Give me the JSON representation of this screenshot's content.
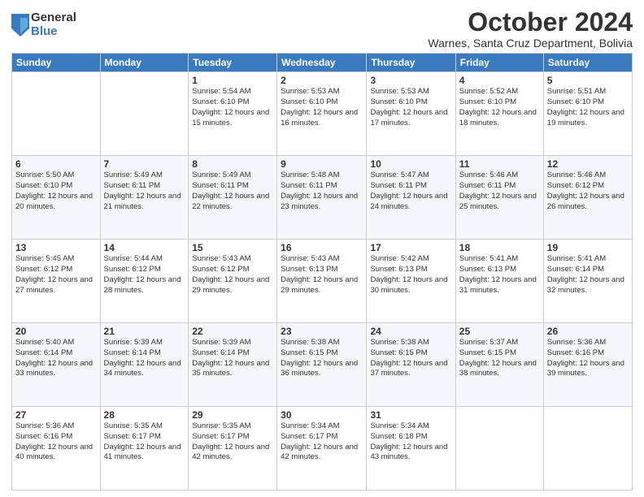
{
  "logo": {
    "general": "General",
    "blue": "Blue"
  },
  "header": {
    "month": "October 2024",
    "location": "Warnes, Santa Cruz Department, Bolivia"
  },
  "days_of_week": [
    "Sunday",
    "Monday",
    "Tuesday",
    "Wednesday",
    "Thursday",
    "Friday",
    "Saturday"
  ],
  "weeks": [
    [
      {
        "day": "",
        "info": ""
      },
      {
        "day": "",
        "info": ""
      },
      {
        "day": "1",
        "info": "Sunrise: 5:54 AM\nSunset: 6:10 PM\nDaylight: 12 hours\nand 15 minutes."
      },
      {
        "day": "2",
        "info": "Sunrise: 5:53 AM\nSunset: 6:10 PM\nDaylight: 12 hours\nand 16 minutes."
      },
      {
        "day": "3",
        "info": "Sunrise: 5:53 AM\nSunset: 6:10 PM\nDaylight: 12 hours\nand 17 minutes."
      },
      {
        "day": "4",
        "info": "Sunrise: 5:52 AM\nSunset: 6:10 PM\nDaylight: 12 hours\nand 18 minutes."
      },
      {
        "day": "5",
        "info": "Sunrise: 5:51 AM\nSunset: 6:10 PM\nDaylight: 12 hours\nand 19 minutes."
      }
    ],
    [
      {
        "day": "6",
        "info": "Sunrise: 5:50 AM\nSunset: 6:10 PM\nDaylight: 12 hours\nand 20 minutes."
      },
      {
        "day": "7",
        "info": "Sunrise: 5:49 AM\nSunset: 6:11 PM\nDaylight: 12 hours\nand 21 minutes."
      },
      {
        "day": "8",
        "info": "Sunrise: 5:49 AM\nSunset: 6:11 PM\nDaylight: 12 hours\nand 22 minutes."
      },
      {
        "day": "9",
        "info": "Sunrise: 5:48 AM\nSunset: 6:11 PM\nDaylight: 12 hours\nand 23 minutes."
      },
      {
        "day": "10",
        "info": "Sunrise: 5:47 AM\nSunset: 6:11 PM\nDaylight: 12 hours\nand 24 minutes."
      },
      {
        "day": "11",
        "info": "Sunrise: 5:46 AM\nSunset: 6:11 PM\nDaylight: 12 hours\nand 25 minutes."
      },
      {
        "day": "12",
        "info": "Sunrise: 5:46 AM\nSunset: 6:12 PM\nDaylight: 12 hours\nand 26 minutes."
      }
    ],
    [
      {
        "day": "13",
        "info": "Sunrise: 5:45 AM\nSunset: 6:12 PM\nDaylight: 12 hours\nand 27 minutes."
      },
      {
        "day": "14",
        "info": "Sunrise: 5:44 AM\nSunset: 6:12 PM\nDaylight: 12 hours\nand 28 minutes."
      },
      {
        "day": "15",
        "info": "Sunrise: 5:43 AM\nSunset: 6:12 PM\nDaylight: 12 hours\nand 29 minutes."
      },
      {
        "day": "16",
        "info": "Sunrise: 5:43 AM\nSunset: 6:13 PM\nDaylight: 12 hours\nand 29 minutes."
      },
      {
        "day": "17",
        "info": "Sunrise: 5:42 AM\nSunset: 6:13 PM\nDaylight: 12 hours\nand 30 minutes."
      },
      {
        "day": "18",
        "info": "Sunrise: 5:41 AM\nSunset: 6:13 PM\nDaylight: 12 hours\nand 31 minutes."
      },
      {
        "day": "19",
        "info": "Sunrise: 5:41 AM\nSunset: 6:14 PM\nDaylight: 12 hours\nand 32 minutes."
      }
    ],
    [
      {
        "day": "20",
        "info": "Sunrise: 5:40 AM\nSunset: 6:14 PM\nDaylight: 12 hours\nand 33 minutes."
      },
      {
        "day": "21",
        "info": "Sunrise: 5:39 AM\nSunset: 6:14 PM\nDaylight: 12 hours\nand 34 minutes."
      },
      {
        "day": "22",
        "info": "Sunrise: 5:39 AM\nSunset: 6:14 PM\nDaylight: 12 hours\nand 35 minutes."
      },
      {
        "day": "23",
        "info": "Sunrise: 5:38 AM\nSunset: 6:15 PM\nDaylight: 12 hours\nand 36 minutes."
      },
      {
        "day": "24",
        "info": "Sunrise: 5:38 AM\nSunset: 6:15 PM\nDaylight: 12 hours\nand 37 minutes."
      },
      {
        "day": "25",
        "info": "Sunrise: 5:37 AM\nSunset: 6:15 PM\nDaylight: 12 hours\nand 38 minutes."
      },
      {
        "day": "26",
        "info": "Sunrise: 5:36 AM\nSunset: 6:16 PM\nDaylight: 12 hours\nand 39 minutes."
      }
    ],
    [
      {
        "day": "27",
        "info": "Sunrise: 5:36 AM\nSunset: 6:16 PM\nDaylight: 12 hours\nand 40 minutes."
      },
      {
        "day": "28",
        "info": "Sunrise: 5:35 AM\nSunset: 6:17 PM\nDaylight: 12 hours\nand 41 minutes."
      },
      {
        "day": "29",
        "info": "Sunrise: 5:35 AM\nSunset: 6:17 PM\nDaylight: 12 hours\nand 42 minutes."
      },
      {
        "day": "30",
        "info": "Sunrise: 5:34 AM\nSunset: 6:17 PM\nDaylight: 12 hours\nand 42 minutes."
      },
      {
        "day": "31",
        "info": "Sunrise: 5:34 AM\nSunset: 6:18 PM\nDaylight: 12 hours\nand 43 minutes."
      },
      {
        "day": "",
        "info": ""
      },
      {
        "day": "",
        "info": ""
      }
    ]
  ]
}
